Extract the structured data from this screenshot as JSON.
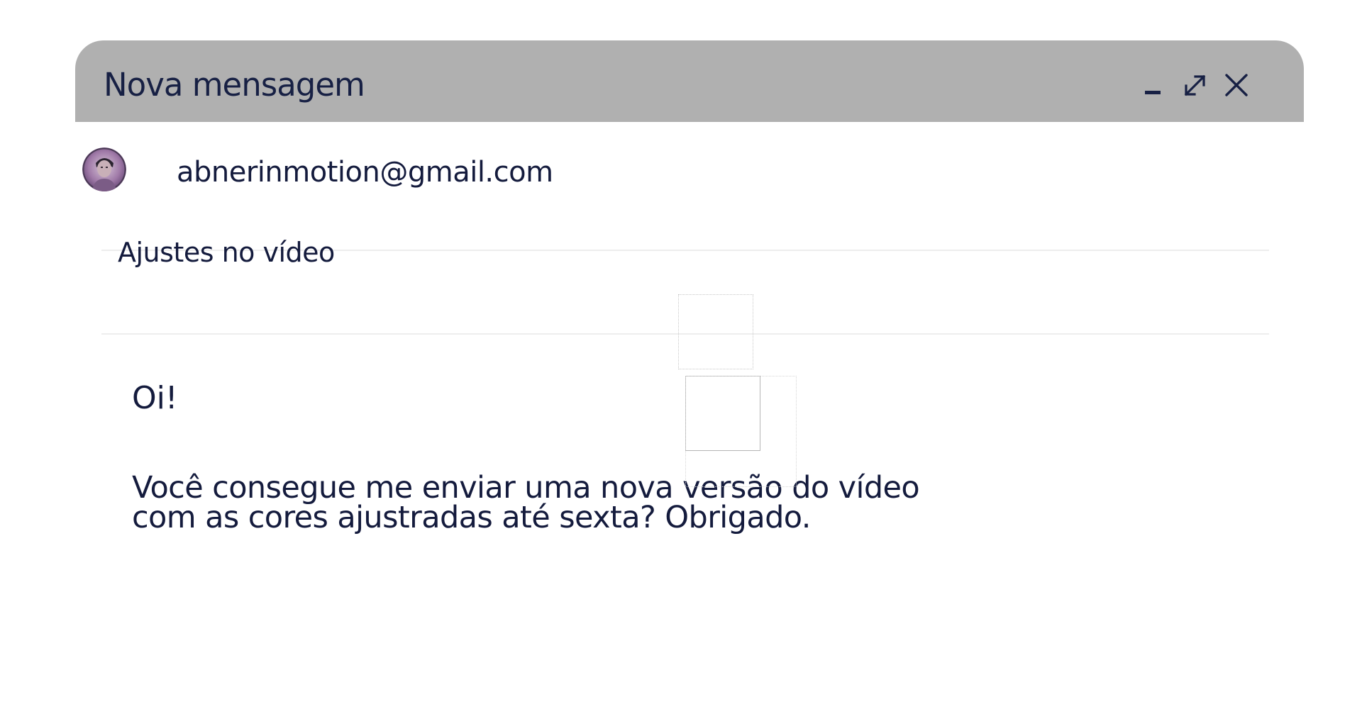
{
  "compose": {
    "title": "Nova mensagem",
    "controls": {
      "minimize_icon": "minimize-icon",
      "expand_icon": "expand-icon",
      "close_icon": "close-icon"
    },
    "to": {
      "avatar_icon": "avatar",
      "address": "abnerinmotion@gmail.com"
    },
    "subject": "Ajustes no vídeo",
    "body": {
      "greeting": "Oi!",
      "line1": "Você consegue me enviar uma nova versão do vídeo",
      "line2": "com as cores ajustradas até sexta? Obrigado."
    }
  },
  "colors": {
    "titlebar_bg": "#b0b0b0",
    "text": "#141b3d",
    "divider": "#ededed"
  }
}
